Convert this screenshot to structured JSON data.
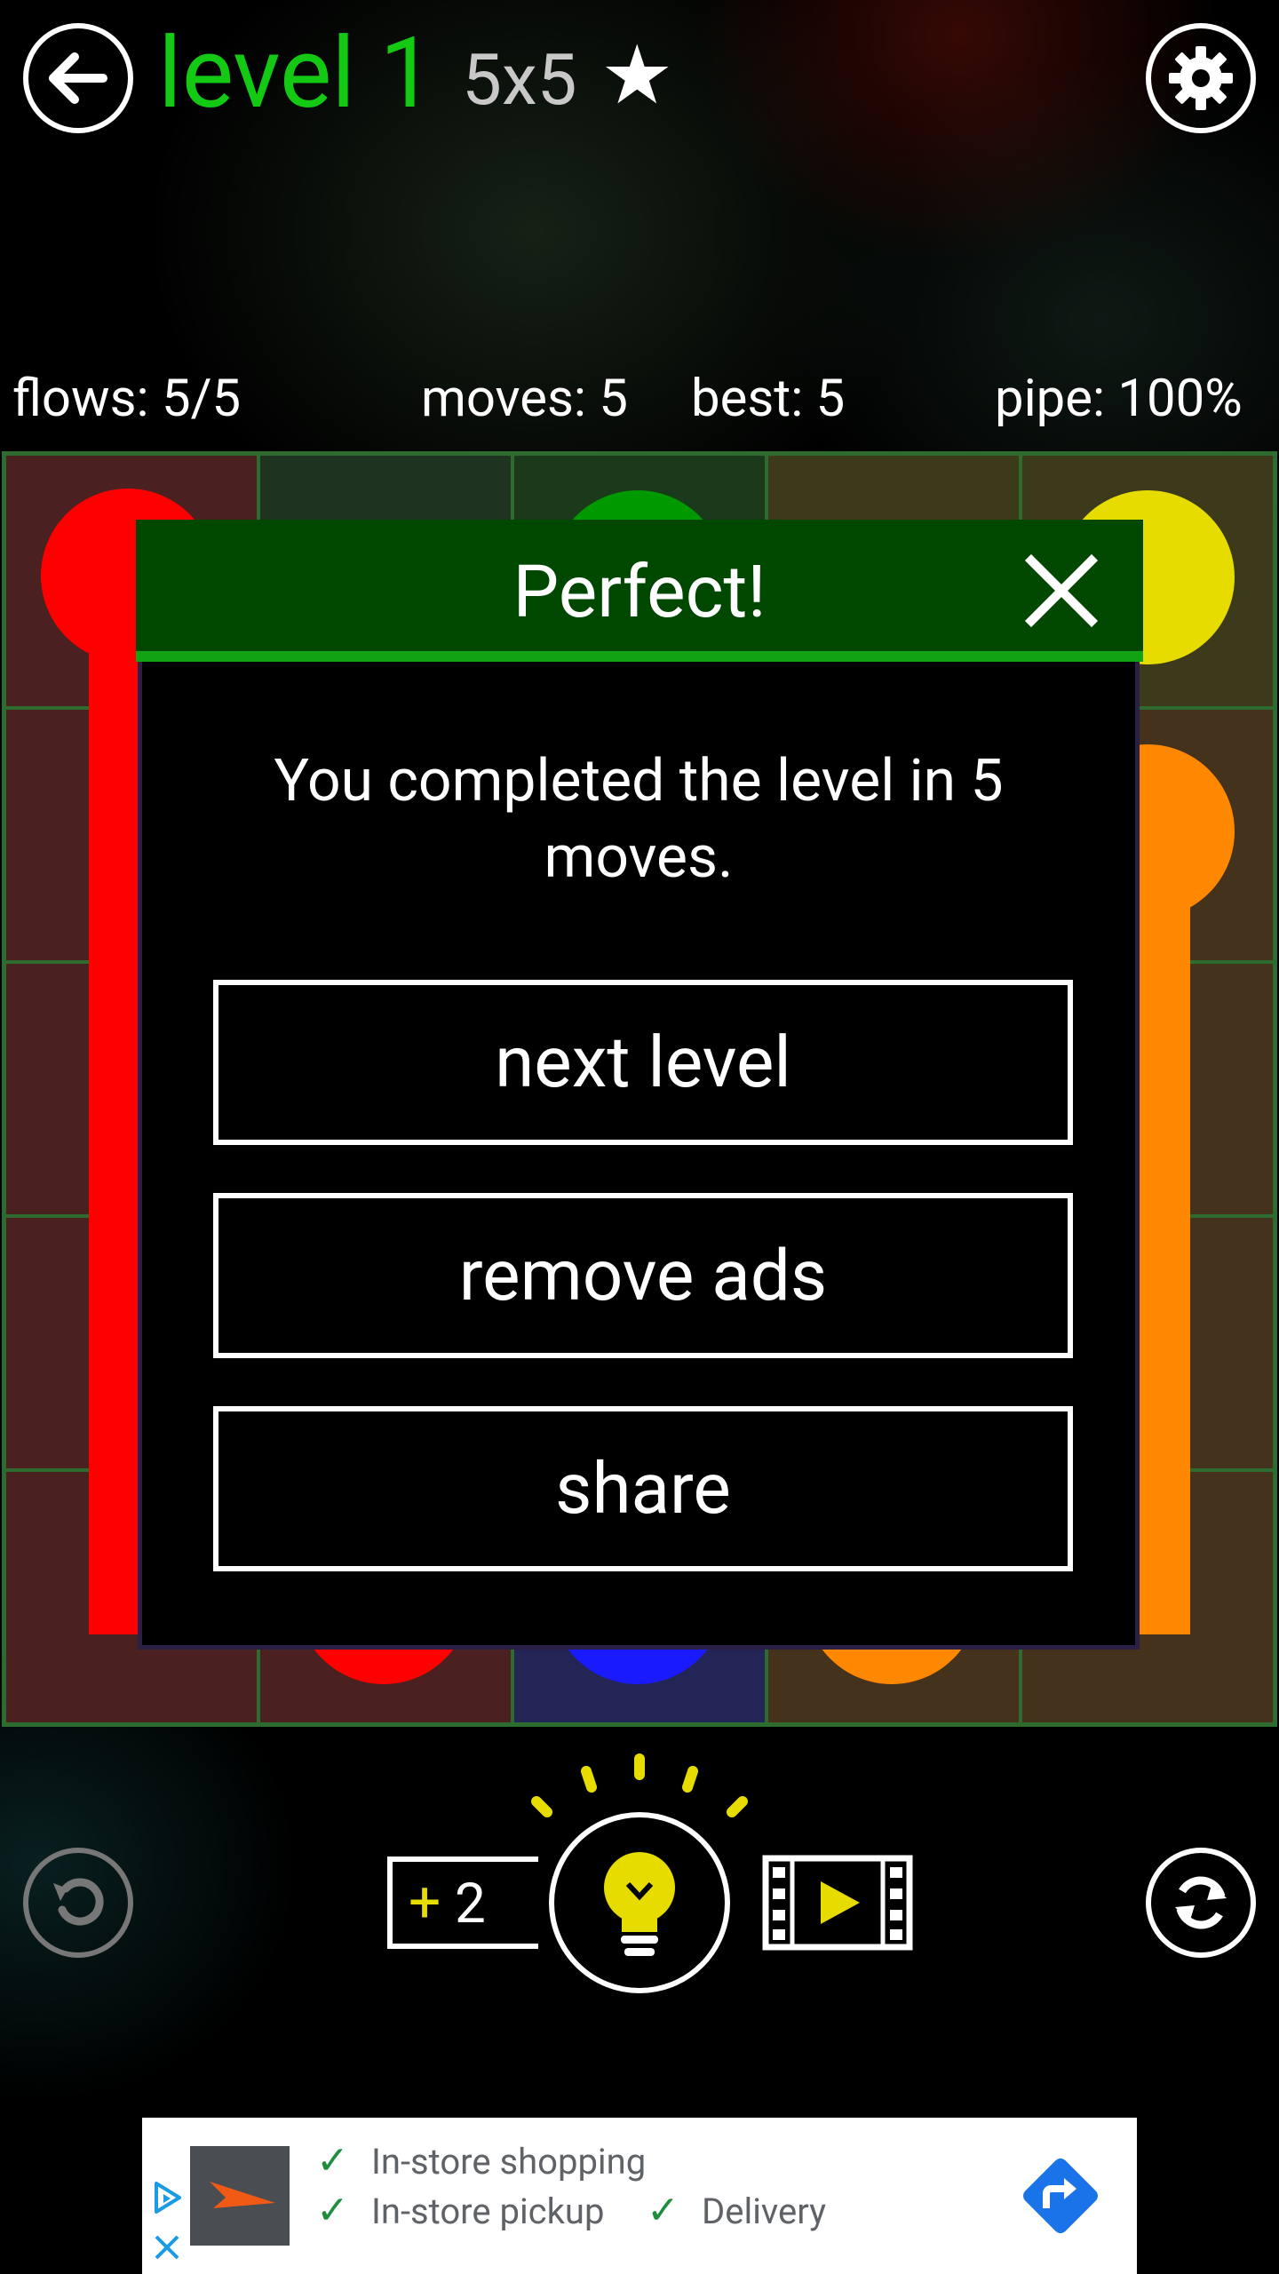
{
  "header": {
    "level_title": "level 1",
    "board_size": "5x5",
    "star_glyph": "★"
  },
  "stats": {
    "flows": "flows: 5/5",
    "moves": "moves: 5",
    "best": "best: 5",
    "pipe": "pipe: 100%"
  },
  "colors": {
    "red": "#ff0000",
    "green": "#009900",
    "yellow": "#e6dc00",
    "orange": "#ff8800",
    "blue": "#1a1aff",
    "accent_green": "#13c913",
    "hint_yellow": "#e6dc00"
  },
  "modal": {
    "title": "Perfect!",
    "message": "You completed the level in 5 moves.",
    "next_label": "next level",
    "remove_ads_label": "remove ads",
    "share_label": "share"
  },
  "toolbar": {
    "hint_bonus": "+2",
    "hint_count": "2"
  },
  "ad": {
    "line1": "In-store shopping",
    "line2a": "In-store pickup",
    "line2b": "Delivery"
  }
}
